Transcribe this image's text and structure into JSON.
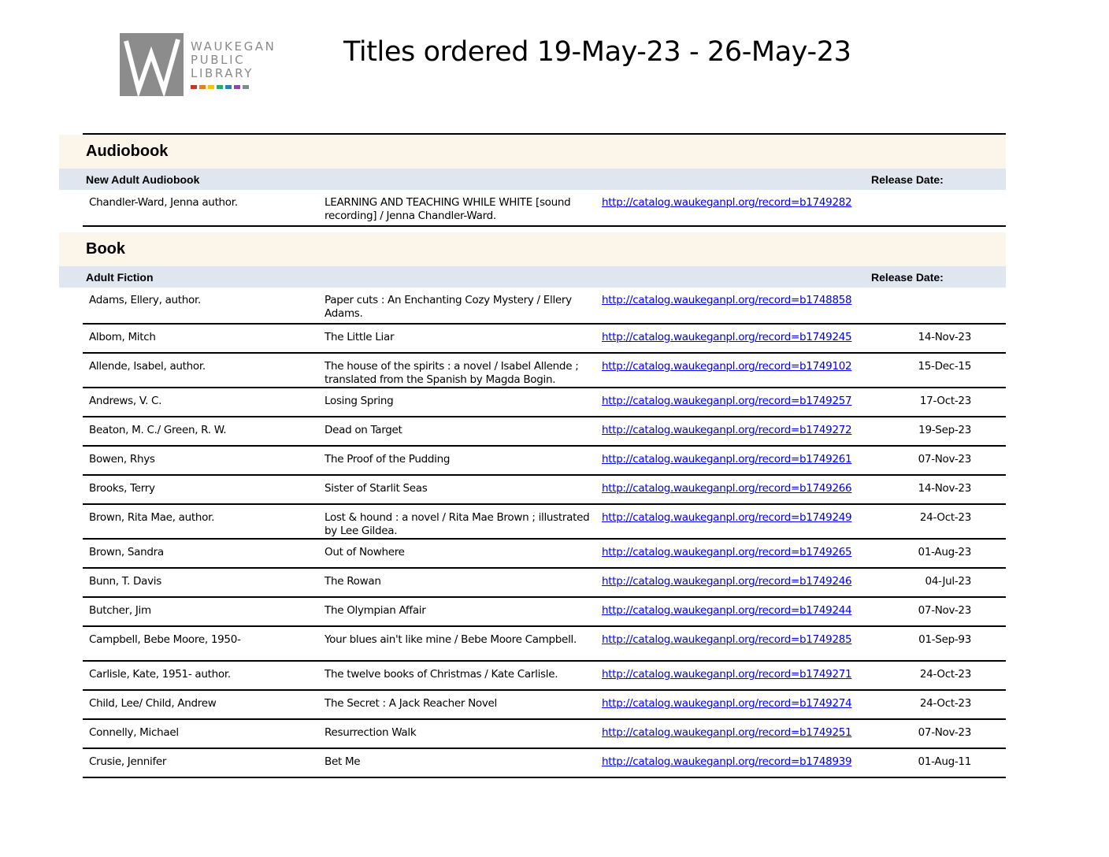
{
  "logo": {
    "lines": [
      "WAUKEGAN",
      "PUBLIC",
      "LIBRARY"
    ],
    "mark_color": "#8c8c8c",
    "dot_colors": [
      "#c0392b",
      "#e67e22",
      "#f1c40f",
      "#27ae60",
      "#2980b9",
      "#8e44ad",
      "#7f8c8d"
    ]
  },
  "title": "Titles ordered 19-May-23 - 26-May-23",
  "colors": {
    "section_bg": "#fbf5ea",
    "category_bg": "#dfe6ef",
    "link": "#0000ee"
  },
  "sections": [
    {
      "name": "Audiobook",
      "category": "New Adult Audiobook",
      "release_label": "Release Date:",
      "rows": [
        {
          "author": "Chandler-Ward, Jenna author.",
          "title": "LEARNING AND TEACHING WHILE WHITE [sound recording] / Jenna Chandler-Ward.",
          "link": "http://catalog.waukeganpl.org/record=b1749282",
          "date": ""
        }
      ]
    },
    {
      "name": "Book",
      "category": "Adult Fiction",
      "release_label": "Release Date:",
      "rows": [
        {
          "author": "Adams, Ellery, author.",
          "title": "Paper cuts : An Enchanting Cozy Mystery / Ellery Adams.",
          "link": "http://catalog.waukeganpl.org/record=b1748858",
          "date": ""
        },
        {
          "author": "Albom, Mitch",
          "title": "The Little Liar",
          "link": "http://catalog.waukeganpl.org/record=b1749245",
          "date": "14-Nov-23"
        },
        {
          "author": "Allende, Isabel, author.",
          "title": "The house of the spirits : a novel / Isabel Allende ; translated from the Spanish by Magda Bogin.",
          "link": "http://catalog.waukeganpl.org/record=b1749102",
          "date": "15-Dec-15"
        },
        {
          "author": "Andrews, V. C.",
          "title": "Losing Spring",
          "link": "http://catalog.waukeganpl.org/record=b1749257",
          "date": "17-Oct-23"
        },
        {
          "author": "Beaton, M. C./ Green, R. W.",
          "title": "Dead on Target",
          "link": "http://catalog.waukeganpl.org/record=b1749272",
          "date": "19-Sep-23"
        },
        {
          "author": "Bowen, Rhys",
          "title": "The Proof of the Pudding",
          "link": "http://catalog.waukeganpl.org/record=b1749261",
          "date": "07-Nov-23"
        },
        {
          "author": "Brooks, Terry",
          "title": "Sister of Starlit Seas",
          "link": "http://catalog.waukeganpl.org/record=b1749266",
          "date": "14-Nov-23"
        },
        {
          "author": "Brown, Rita Mae, author.",
          "title": "Lost & hound : a novel / Rita Mae Brown ; illustrated by Lee Gildea.",
          "link": "http://catalog.waukeganpl.org/record=b1749249",
          "date": "24-Oct-23"
        },
        {
          "author": "Brown, Sandra",
          "title": "Out of Nowhere",
          "link": "http://catalog.waukeganpl.org/record=b1749265",
          "date": "01-Aug-23"
        },
        {
          "author": "Bunn, T. Davis",
          "title": "The Rowan",
          "link": "http://catalog.waukeganpl.org/record=b1749246",
          "date": "04-Jul-23"
        },
        {
          "author": "Butcher, Jim",
          "title": "The Olympian Affair",
          "link": "http://catalog.waukeganpl.org/record=b1749244",
          "date": "07-Nov-23"
        },
        {
          "author": "Campbell, Bebe Moore, 1950-",
          "title": "Your blues ain't like mine / Bebe Moore Campbell.",
          "link": "http://catalog.waukeganpl.org/record=b1749285",
          "date": "01-Sep-93"
        },
        {
          "author": "Carlisle, Kate, 1951- author.",
          "title": "The twelve books of Christmas / Kate Carlisle.",
          "link": "http://catalog.waukeganpl.org/record=b1749271",
          "date": "24-Oct-23"
        },
        {
          "author": "Child, Lee/ Child, Andrew",
          "title": "The Secret : A Jack Reacher Novel",
          "link": "http://catalog.waukeganpl.org/record=b1749274",
          "date": "24-Oct-23"
        },
        {
          "author": "Connelly, Michael",
          "title": "Resurrection Walk",
          "link": "http://catalog.waukeganpl.org/record=b1749251",
          "date": "07-Nov-23"
        },
        {
          "author": "Crusie, Jennifer",
          "title": "Bet Me",
          "link": "http://catalog.waukeganpl.org/record=b1748939",
          "date": "01-Aug-11"
        }
      ]
    }
  ]
}
